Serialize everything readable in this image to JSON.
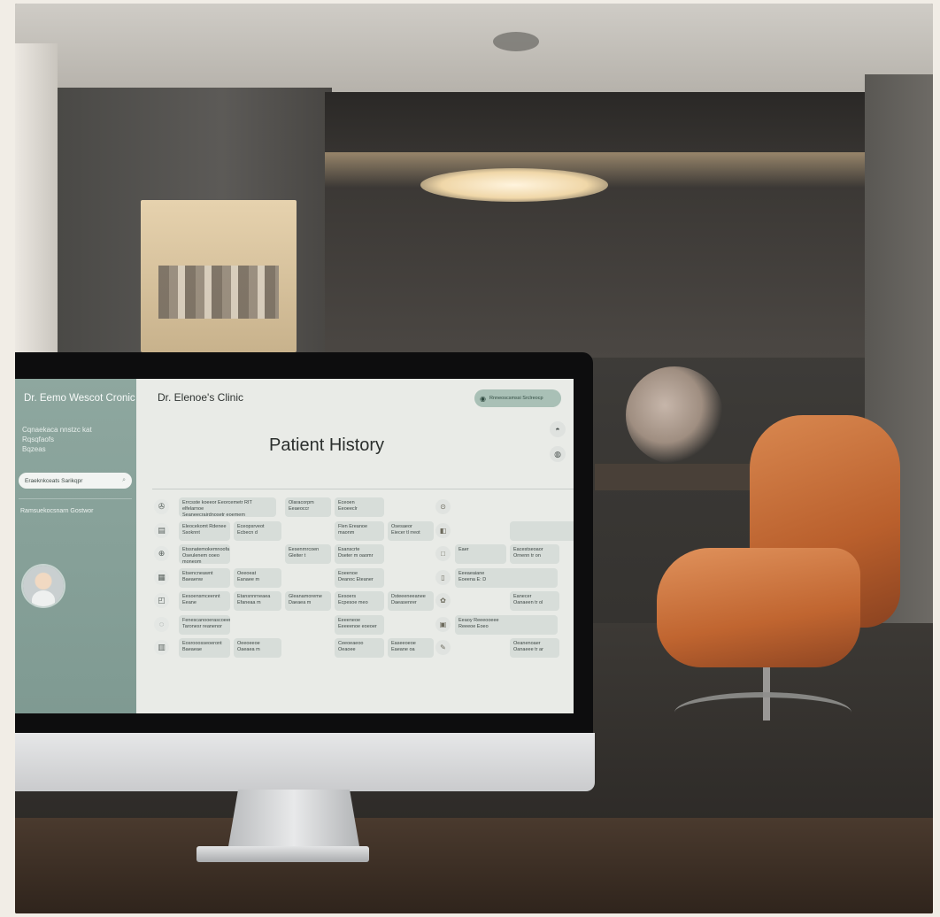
{
  "sidebar": {
    "brand": "Dr. Eemo Wescot Cronic",
    "subtitle": "Cqnaekaca nnstzc kat\nRqsqfaofs\nBqzeas",
    "search_text": "Eraeknkceats Sarikqpr",
    "search_icon": "search-icon",
    "link": "Ramsuekocsnarn Gostwor"
  },
  "header": {
    "clinic_name": "Dr. Elenoe's Clinic",
    "pill_text": "Rnneoscsmssi Srclreocp",
    "page_title": "Patient History"
  },
  "rows": [
    {
      "icon": "✇",
      "cells": [
        {
          "col": 1,
          "text": "Errcsste koeeor Eeorcemetr RIT elfelarnoe\nSeaneecrairdnosetr eoemem"
        },
        {
          "col": 3,
          "text": "Olaracorpm\nEeaeoccr"
        },
        {
          "col": 4,
          "text": "Eceoen\nEeoeeclr"
        }
      ],
      "mid_icon": "⊙",
      "right": []
    },
    {
      "icon": "▤",
      "cells": [
        {
          "col": 1,
          "text": "Eleocekomt Rdenee\nSsoknnt"
        },
        {
          "col": 2,
          "text": "Eceopsrveot\nEcbecn d"
        },
        {
          "col": 4,
          "text": "Flen Ereanoe\nmaonm"
        },
        {
          "col": 5,
          "text": "Osesaeor\nEiecer tl rreot"
        }
      ],
      "mid_icon": "◧",
      "right": [
        {
          "col": 7,
          "text": ""
        }
      ]
    },
    {
      "icon": "⊕",
      "cells": [
        {
          "col": 1,
          "text": "Etssnatemokemnoofa\nOseulenem ooeo moneom"
        },
        {
          "col": 3,
          "text": "Eesenrnrcoen\nGleiter t"
        },
        {
          "col": 4,
          "text": "Esanscrte\nDseter m oaomr"
        }
      ],
      "mid_icon": "□",
      "right": [
        {
          "col": 6,
          "text": "Eaer"
        },
        {
          "col": 7,
          "text": "Eacestseoaor\nOrnenn tr on"
        }
      ]
    },
    {
      "icon": "▦",
      "cells": [
        {
          "col": 1,
          "text": "Etsencneawnt\nBaeaenw"
        },
        {
          "col": 2,
          "text": "Oeeoeat\nEanaee m"
        },
        {
          "col": 4,
          "text": "Eoeenoe\nDeanoc Eteaner"
        }
      ],
      "mid_icon": "▯",
      "right": [
        {
          "col": 6,
          "text": "Eeeaeaiane\nEoeena E: D"
        }
      ]
    },
    {
      "icon": "◰",
      "cells": [
        {
          "col": 1,
          "text": "Eesoensmceennt\nEeane"
        },
        {
          "col": 2,
          "text": "Etansnnrneaea\nEfaneaa m"
        },
        {
          "col": 3,
          "text": "Gleanamoreme\nDaeaea m"
        },
        {
          "col": 4,
          "text": "Eesoers\nEcpesoe meo"
        },
        {
          "col": 5,
          "text": "Dsteeeneeanee\nDaeasenrer"
        }
      ],
      "mid_icon": "✿",
      "right": [
        {
          "col": 7,
          "text": "Eanecer\nOanaeen tr ol"
        }
      ]
    },
    {
      "icon": "◌",
      "cells": [
        {
          "col": 1,
          "text": "Fenescanooerascoeenomeneoeraeramra\nTaronesr reanenor"
        },
        {
          "col": 4,
          "text": "Eeeeneoe\nEeeeenoe eoeoer"
        }
      ],
      "mid_icon": "▣",
      "right": [
        {
          "col": 6,
          "text": "Eeaoy Reeeooeee\nReeeoe Eoeo"
        }
      ]
    },
    {
      "icon": "▥",
      "cells": [
        {
          "col": 1,
          "text": "Eosrooosseoeront\nBaeaeae"
        },
        {
          "col": 2,
          "text": "Oeeoeeoe\nOaeaea m"
        },
        {
          "col": 4,
          "text": "Ceeoeaeoo\nOeaoee"
        },
        {
          "col": 5,
          "text": "Easeeoeoe\nEaeane oa"
        }
      ],
      "mid_icon": "✎",
      "right": [
        {
          "col": 7,
          "text": "Oeanenoaer\nOanaeee tr ar"
        }
      ]
    }
  ],
  "colors": {
    "sidebar": "#8ea79f",
    "screen": "#e9ebe7",
    "pill": "#a9c0b6",
    "cell": "#d7ddd9",
    "chair": "#c06530"
  }
}
